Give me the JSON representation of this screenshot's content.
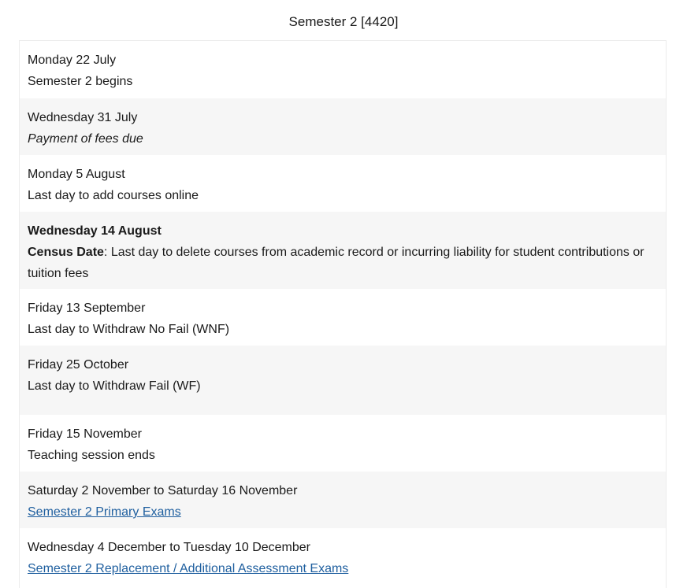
{
  "title": "Semester 2 [4420]",
  "rows": [
    {
      "date": "Monday 22 July",
      "description": "Semester 2 begins"
    },
    {
      "date": "Wednesday 31 July",
      "description": "Payment of fees due"
    },
    {
      "date": "Monday 5 August",
      "description": "Last day to add courses online"
    },
    {
      "date": "Wednesday 14 August",
      "label": "Census Date",
      "description": ": Last day to delete courses from academic record or incurring liability for student contributions or tuition fees"
    },
    {
      "date": "Friday 13 September",
      "description": "Last day to Withdraw No Fail (WNF)"
    },
    {
      "date": "Friday 25 October",
      "description": "Last day to Withdraw Fail (WF)"
    },
    {
      "date": "Friday 15 November",
      "description": "Teaching session ends"
    },
    {
      "date": "Saturday 2 November to Saturday 16 November",
      "link": "Semester 2 Primary Exams"
    },
    {
      "date": "Wednesday 4 December to Tuesday 10 December",
      "link": "Semester 2 Replacement / Additional Assessment Exams"
    }
  ]
}
